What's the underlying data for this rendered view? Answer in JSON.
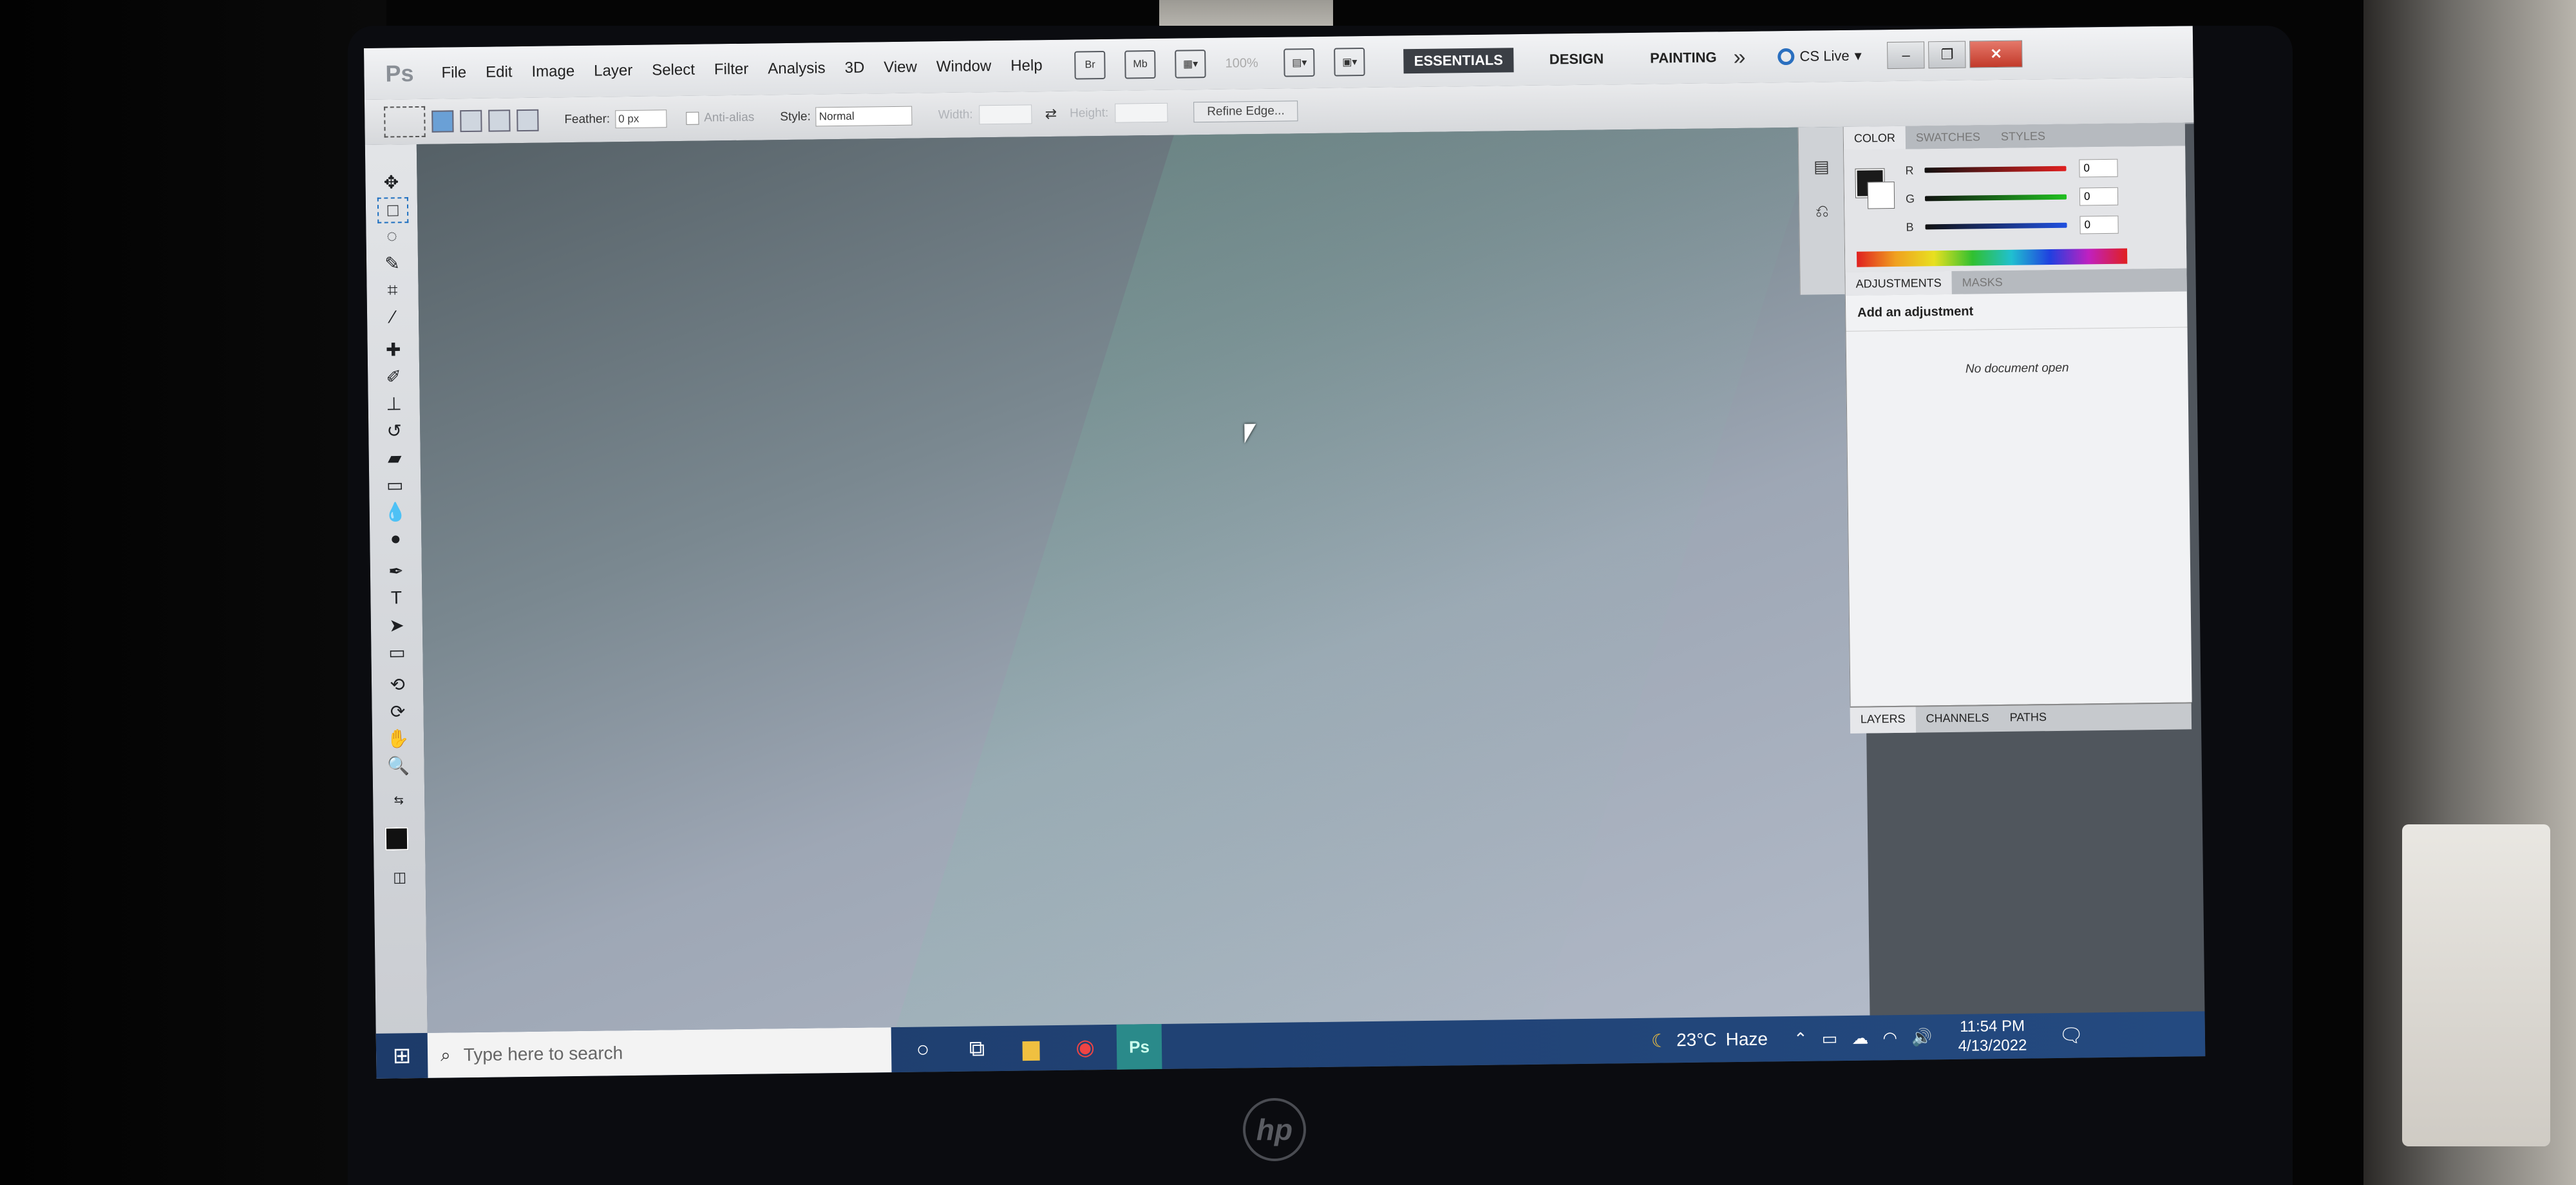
{
  "app": {
    "logo": "Ps"
  },
  "menu": [
    "File",
    "Edit",
    "Image",
    "Layer",
    "Select",
    "Filter",
    "Analysis",
    "3D",
    "View",
    "Window",
    "Help"
  ],
  "toolbar": {
    "zoom": "100%"
  },
  "workspaces": {
    "essentials": "ESSENTIALS",
    "design": "DESIGN",
    "painting": "PAINTING",
    "more": "»"
  },
  "cslive": "CS Live",
  "options": {
    "feather_label": "Feather:",
    "feather_value": "0 px",
    "antialias_label": "Anti-alias",
    "style_label": "Style:",
    "style_value": "Normal",
    "width_label": "Width:",
    "height_label": "Height:",
    "refine_button": "Refine Edge..."
  },
  "color_panel": {
    "tabs": [
      "COLOR",
      "SWATCHES",
      "STYLES"
    ],
    "channels": [
      {
        "label": "R",
        "value": "0"
      },
      {
        "label": "G",
        "value": "0"
      },
      {
        "label": "B",
        "value": "0"
      }
    ]
  },
  "adjustments": {
    "tabs": [
      "ADJUSTMENTS",
      "MASKS"
    ],
    "title": "Add an adjustment",
    "empty": "No document open"
  },
  "layers_tabs": [
    "LAYERS",
    "CHANNELS",
    "PATHS"
  ],
  "taskbar": {
    "search_placeholder": "Type here to search",
    "temperature": "23°C",
    "weather": "Haze",
    "time": "11:54 PM",
    "date": "4/13/2022",
    "ps_label": "Ps"
  },
  "colors": {
    "accent": "#2a6fbf",
    "taskbar": "#1d3b6a",
    "close": "#c23a2a"
  }
}
